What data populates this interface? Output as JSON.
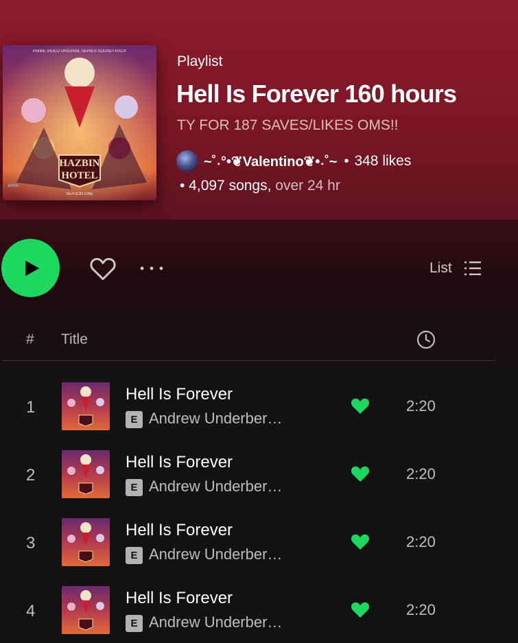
{
  "playlist": {
    "type_label": "Playlist",
    "title": "Hell Is Forever 160 hours",
    "description": "TY FOR 187 SAVES/LIKES OMS!!",
    "owner": "~˚˖°•❦Valentino❦•˖˚~",
    "separator": "•",
    "likes": "348 likes",
    "songs": "• 4,097 songs,",
    "duration": " over 24 hr",
    "cover_text": {
      "top": "PRIME VIDEO ORIGINAL SERIES SOUNDTRACK",
      "logo_line1": "HAZBIN",
      "logo_line2": "HOTEL",
      "bottom": "SEASON ONE",
      "badge": "prime"
    }
  },
  "actions": {
    "play_icon": "play-icon",
    "like_icon": "heart-outline-icon",
    "more_icon": "more-horizontal-icon",
    "view_label": "List",
    "view_icon": "list-view-icon"
  },
  "table_header": {
    "number": "#",
    "title": "Title",
    "duration_icon": "clock-icon"
  },
  "tracks": [
    {
      "number": "1",
      "title": "Hell Is Forever",
      "explicit": "E",
      "artist": "Andrew Underber…",
      "liked": true,
      "duration": "2:20"
    },
    {
      "number": "2",
      "title": "Hell Is Forever",
      "explicit": "E",
      "artist": "Andrew Underber…",
      "liked": true,
      "duration": "2:20"
    },
    {
      "number": "3",
      "title": "Hell Is Forever",
      "explicit": "E",
      "artist": "Andrew Underber…",
      "liked": true,
      "duration": "2:20"
    },
    {
      "number": "4",
      "title": "Hell Is Forever",
      "explicit": "E",
      "artist": "Andrew Underber…",
      "liked": true,
      "duration": "2:20"
    }
  ],
  "colors": {
    "accent_green": "#1ed760",
    "header_red": "#8e1b2b",
    "background": "#121212"
  }
}
